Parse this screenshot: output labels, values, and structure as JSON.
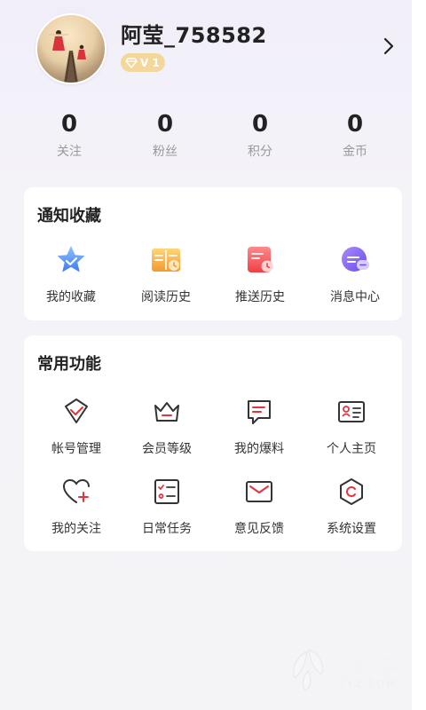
{
  "profile": {
    "username": "阿莹_758582",
    "level": "V 1"
  },
  "stats": [
    {
      "value": "0",
      "label": "关注"
    },
    {
      "value": "0",
      "label": "粉丝"
    },
    {
      "value": "0",
      "label": "积分"
    },
    {
      "value": "0",
      "label": "金币"
    }
  ],
  "notice_section": {
    "title": "通知收藏",
    "items": [
      {
        "label": "我的收藏",
        "icon": "star-icon"
      },
      {
        "label": "阅读历史",
        "icon": "book-icon"
      },
      {
        "label": "推送历史",
        "icon": "calendar-clock-icon"
      },
      {
        "label": "消息中心",
        "icon": "chat-bubble-icon"
      }
    ]
  },
  "common_section": {
    "title": "常用功能",
    "items": [
      {
        "label": "帐号管理",
        "icon": "account-icon"
      },
      {
        "label": "会员等级",
        "icon": "crown-icon"
      },
      {
        "label": "我的爆料",
        "icon": "message-icon"
      },
      {
        "label": "个人主页",
        "icon": "id-card-icon"
      },
      {
        "label": "我的关注",
        "icon": "heart-plus-icon"
      },
      {
        "label": "日常任务",
        "icon": "task-list-icon"
      },
      {
        "label": "意见反馈",
        "icon": "envelope-icon"
      },
      {
        "label": "系统设置",
        "icon": "settings-icon"
      }
    ]
  },
  "watermark": {
    "name": "七叶子",
    "site": "7YZ.COM"
  },
  "colors": {
    "accent_red": "#e6343f",
    "badge_gold": "#f4d79a",
    "card_bg": "#ffffff"
  }
}
